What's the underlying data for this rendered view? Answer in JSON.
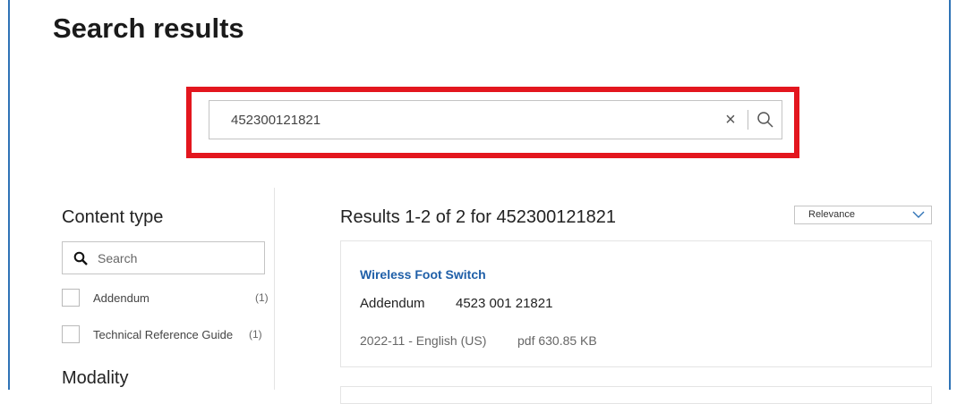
{
  "page": {
    "title": "Search results"
  },
  "search": {
    "value": "452300121821",
    "clear_label": "×"
  },
  "sidebar": {
    "content_type_heading": "Content type",
    "facet_search_label": "Search",
    "facets": [
      {
        "label": "Addendum",
        "count": "(1)"
      },
      {
        "label": "Technical Reference Guide",
        "count": "(1)"
      }
    ],
    "modality_heading": "Modality"
  },
  "results": {
    "summary": "Results 1-2 of 2 for 452300121821",
    "sort": {
      "selected": "Relevance"
    },
    "items": [
      {
        "title": "Wireless Foot Switch",
        "type": "Addendum",
        "part_number": "4523 001 21821",
        "meta": "2022-11 - English (US)",
        "file": "pdf 630.85 KB"
      }
    ]
  },
  "colors": {
    "accent_link": "#1f5fa8",
    "highlight": "#e3161e",
    "frame": "#2f73b6"
  }
}
